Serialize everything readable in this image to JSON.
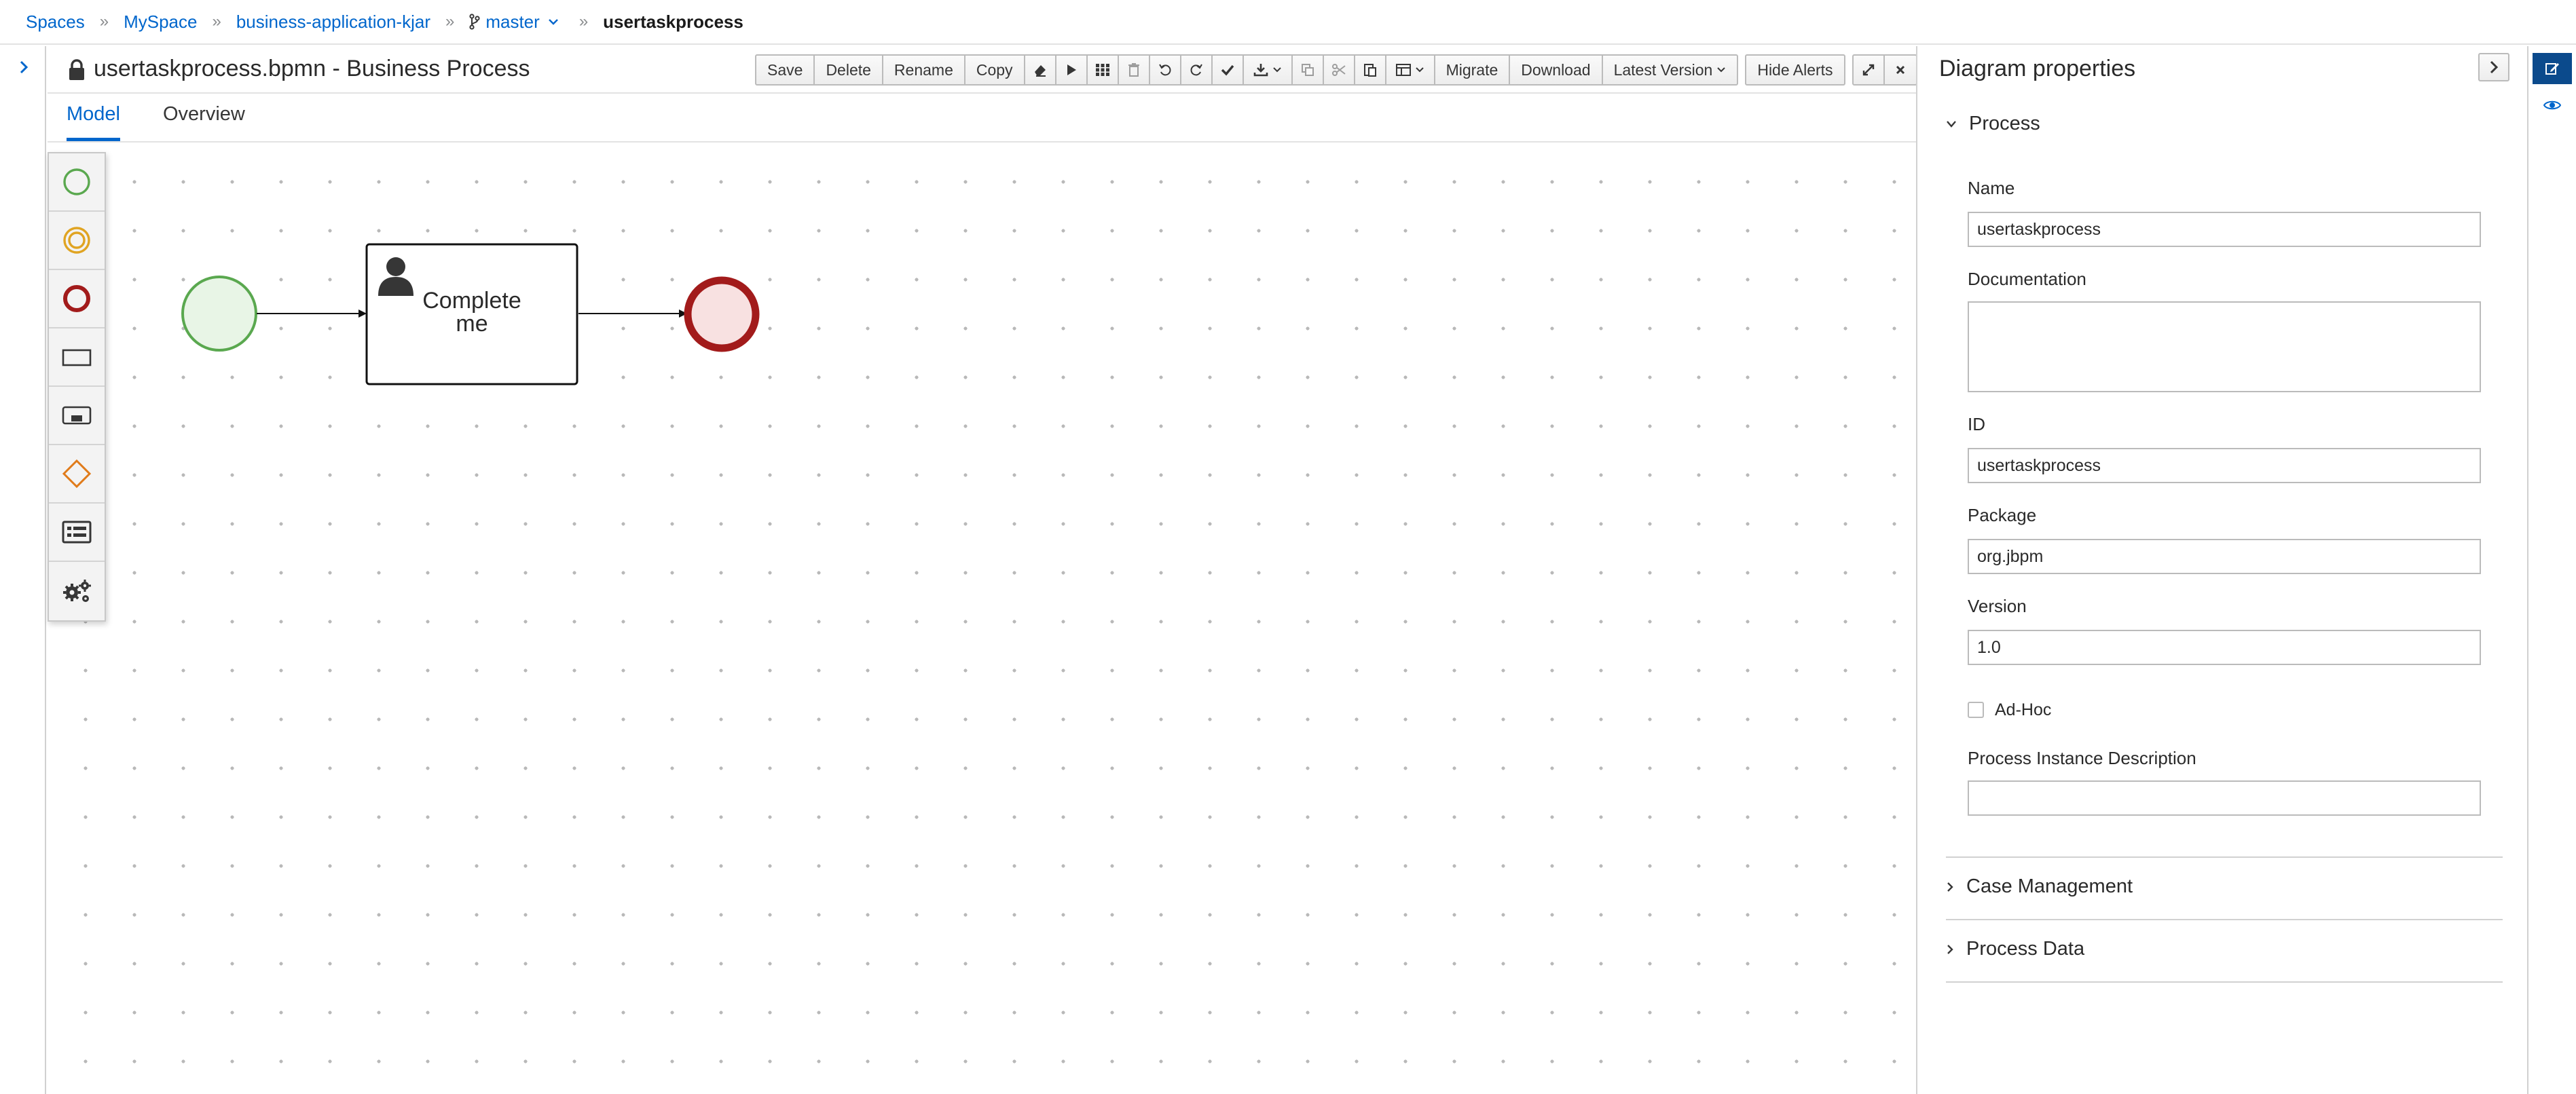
{
  "breadcrumb": {
    "items": [
      "Spaces",
      "MySpace",
      "business-application-kjar"
    ],
    "branch": "master",
    "current": "usertaskprocess"
  },
  "editor": {
    "title": "usertaskprocess.bpmn - Business Process",
    "toolbar": {
      "save": "Save",
      "delete": "Delete",
      "rename": "Rename",
      "copy": "Copy",
      "migrate": "Migrate",
      "download": "Download",
      "latest_version": "Latest Version",
      "hide_alerts": "Hide Alerts"
    },
    "tabs": [
      "Model",
      "Overview"
    ],
    "active_tab": "Model"
  },
  "diagram": {
    "task_label_line1": "Complete",
    "task_label_line2": "me"
  },
  "properties": {
    "title": "Diagram properties",
    "section_process": "Process",
    "name_label": "Name",
    "name_value": "usertaskprocess",
    "documentation_label": "Documentation",
    "documentation_value": "",
    "id_label": "ID",
    "id_value": "usertaskprocess",
    "package_label": "Package",
    "package_value": "org.jbpm",
    "version_label": "Version",
    "version_value": "1.0",
    "adhoc_label": "Ad-Hoc",
    "pid_label": "Process Instance Description",
    "pid_value": "",
    "section_case": "Case Management",
    "section_data": "Process Data"
  },
  "colors": {
    "link": "#0066cc",
    "start_event": "#5aa84f",
    "end_event": "#a21b1b",
    "intermediate_event": "#e0a422",
    "gateway": "#e07b1a",
    "rail_active": "#0b4a8c"
  }
}
